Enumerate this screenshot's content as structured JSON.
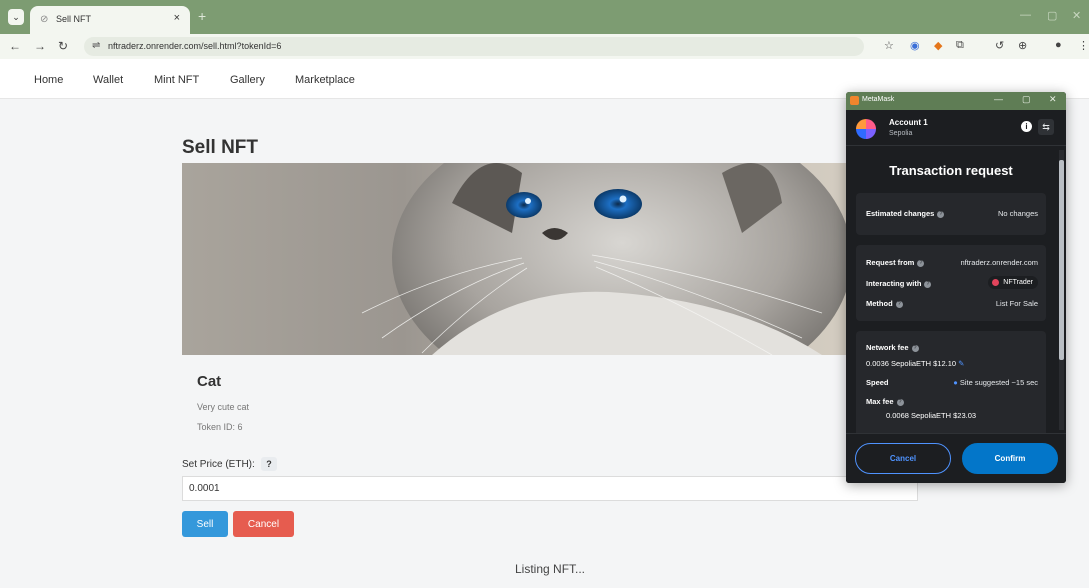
{
  "browser": {
    "tab_title": "Sell NFT",
    "url": "nftraderz.onrender.com/sell.html?tokenId=6"
  },
  "nav": {
    "items": [
      "Home",
      "Wallet",
      "Mint NFT",
      "Gallery",
      "Marketplace"
    ]
  },
  "page": {
    "title": "Sell NFT",
    "nft_name": "Cat",
    "nft_description": "Very cute cat",
    "token_id": "Token ID: 6",
    "price_label": "Set Price (ETH):",
    "help_label": "?",
    "price_value": "0.0001",
    "sell_label": "Sell",
    "cancel_label": "Cancel",
    "status": "Listing NFT..."
  },
  "metamask": {
    "window_title": "MetaMask",
    "account_name": "Account 1",
    "network": "Sepolia",
    "heading": "Transaction request",
    "estimated_changes_label": "Estimated changes",
    "estimated_changes_value": "No changes",
    "request_from_label": "Request from",
    "request_from_value": "nftraderz.onrender.com",
    "interacting_with_label": "Interacting with",
    "interacting_with_value": "NFTrader",
    "method_label": "Method",
    "method_value": "List For Sale",
    "network_fee_label": "Network fee",
    "network_fee_value": "0.0036 SepoliaETH $12.10",
    "speed_label": "Speed",
    "speed_value": "Site suggested ~15 sec",
    "max_fee_label": "Max fee",
    "max_fee_value": "0.0068 SepoliaETH $23.03",
    "cancel_label": "Cancel",
    "confirm_label": "Confirm"
  },
  "colors": {
    "browser_frame": "#7d9c72",
    "sell_button": "#3498db",
    "cancel_button": "#e65c4f",
    "metamask_confirm": "#0376c9",
    "metamask_bg": "#1c1e21"
  }
}
